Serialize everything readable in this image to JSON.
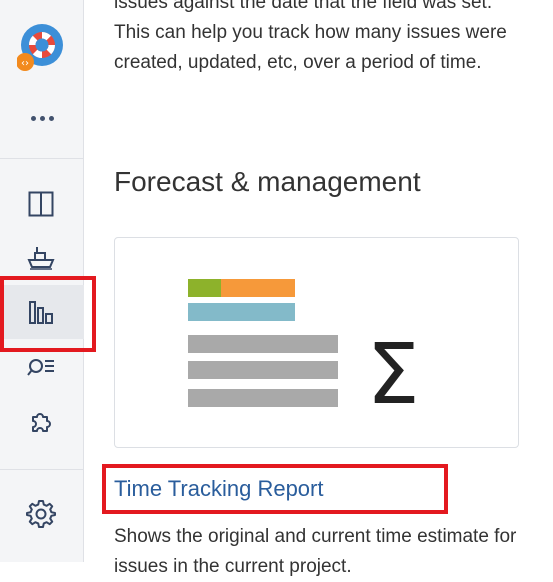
{
  "sidebar": {
    "logo_icon": "lifebuoy-logo-icon",
    "more_icon": "more-icon",
    "items": [
      {
        "icon": "board-icon",
        "active": false
      },
      {
        "icon": "ship-icon",
        "active": false
      },
      {
        "icon": "reports-icon",
        "active": true
      },
      {
        "icon": "search-issues-icon",
        "active": false
      },
      {
        "icon": "addons-icon",
        "active": false
      }
    ],
    "settings_icon": "gear-icon"
  },
  "content": {
    "intro_text": "issues against the date that the field was set. This can help you track how many issues were created, updated, etc, over a period of time.",
    "section_title": "Forecast & management",
    "report": {
      "title": "Time Tracking Report",
      "description": "Shows the original and current time estimate for issues in the current project."
    }
  },
  "colors": {
    "highlight": "#e3191f",
    "link": "#2a5d9c",
    "green": "#8db22b",
    "orange": "#f6993a",
    "teal": "#83bac9",
    "gray": "#a9a9a9"
  }
}
